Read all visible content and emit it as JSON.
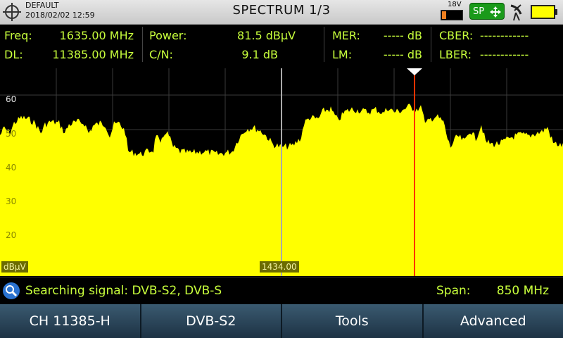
{
  "header": {
    "profile": "DEFAULT",
    "datetime": "2018/02/02 12:59",
    "title": "SPECTRUM 1/3",
    "lnb_voltage": "18V",
    "sp_label": "SP"
  },
  "measurements": {
    "freq_label": "Freq:",
    "freq_value": "1635.00 MHz",
    "dl_label": "DL:",
    "dl_value": "11385.00 MHz",
    "power_label": "Power:",
    "power_value": "81.5 dBµV",
    "cn_label": "C/N:",
    "cn_value": "9.1 dB",
    "mer_label": "MER:",
    "mer_value": "----- dB",
    "lm_label": "LM:",
    "lm_value": "----- dB",
    "cber_label": "CBER:",
    "cber_value": "------------",
    "lber_label": "LBER:",
    "lber_value": "------------"
  },
  "spectrum": {
    "unit": "dBµV",
    "center_freq": "1434.00",
    "y_ticks": [
      "60",
      "50",
      "40",
      "30",
      "20"
    ],
    "colors": {
      "trace": "#ffff00",
      "marker": "#ff3300",
      "grid": "#3a3a3a",
      "center_line": "#aaaaaa"
    }
  },
  "status": {
    "text": "Searching signal: DVB-S2, DVB-S",
    "span_label": "Span:",
    "span_value": "850 MHz"
  },
  "softkeys": [
    "CH 11385-H",
    "DVB-S2",
    "Tools",
    "Advanced"
  ]
}
